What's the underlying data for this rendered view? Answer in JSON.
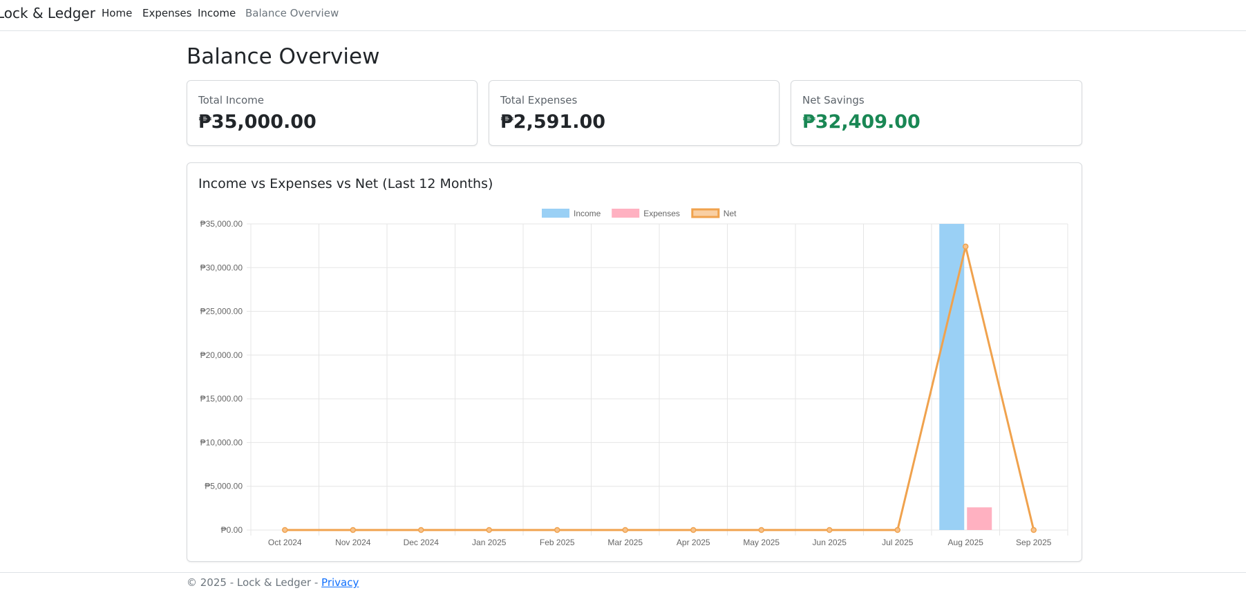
{
  "nav": {
    "brand": "Lock & Ledger",
    "links": [
      {
        "label": "Home"
      },
      {
        "label": "Expenses"
      },
      {
        "label": "Income"
      },
      {
        "label": "Balance Overview"
      }
    ]
  },
  "page_title": "Balance Overview",
  "stats": [
    {
      "label": "Total Income",
      "value": "₱35,000.00"
    },
    {
      "label": "Total Expenses",
      "value": "₱2,591.00"
    },
    {
      "label": "Net Savings",
      "value": "₱32,409.00"
    }
  ],
  "colors": {
    "net_savings": "#198754",
    "income": "#9ad0f5",
    "expenses": "#ffb1c1",
    "net": "#f0a24d"
  },
  "chart_card_title": "Income vs Expenses vs Net (Last 12 Months)",
  "chart_data": {
    "type": "bar",
    "categories": [
      "Oct 2024",
      "Nov 2024",
      "Dec 2024",
      "Jan 2025",
      "Feb 2025",
      "Mar 2025",
      "Apr 2025",
      "May 2025",
      "Jun 2025",
      "Jul 2025",
      "Aug 2025",
      "Sep 2025"
    ],
    "series": [
      {
        "name": "Income",
        "type": "bar",
        "values": [
          0,
          0,
          0,
          0,
          0,
          0,
          0,
          0,
          0,
          0,
          35000,
          0
        ]
      },
      {
        "name": "Expenses",
        "type": "bar",
        "values": [
          0,
          0,
          0,
          0,
          0,
          0,
          0,
          0,
          0,
          0,
          2591,
          0
        ]
      },
      {
        "name": "Net",
        "type": "line",
        "values": [
          0,
          0,
          0,
          0,
          0,
          0,
          0,
          0,
          0,
          0,
          32409,
          0
        ]
      }
    ],
    "ylim": [
      0,
      35000
    ],
    "yticks": [
      {
        "value": 0,
        "label": "₱0.00"
      },
      {
        "value": 5000,
        "label": "₱5,000.00"
      },
      {
        "value": 10000,
        "label": "₱10,000.00"
      },
      {
        "value": 15000,
        "label": "₱15,000.00"
      },
      {
        "value": 20000,
        "label": "₱20,000.00"
      },
      {
        "value": 25000,
        "label": "₱25,000.00"
      },
      {
        "value": 30000,
        "label": "₱30,000.00"
      },
      {
        "value": 35000,
        "label": "₱35,000.00"
      }
    ],
    "grid": true,
    "legend_position": "top"
  },
  "footer": {
    "text": "© 2025 - Lock & Ledger - ",
    "link": "Privacy"
  }
}
